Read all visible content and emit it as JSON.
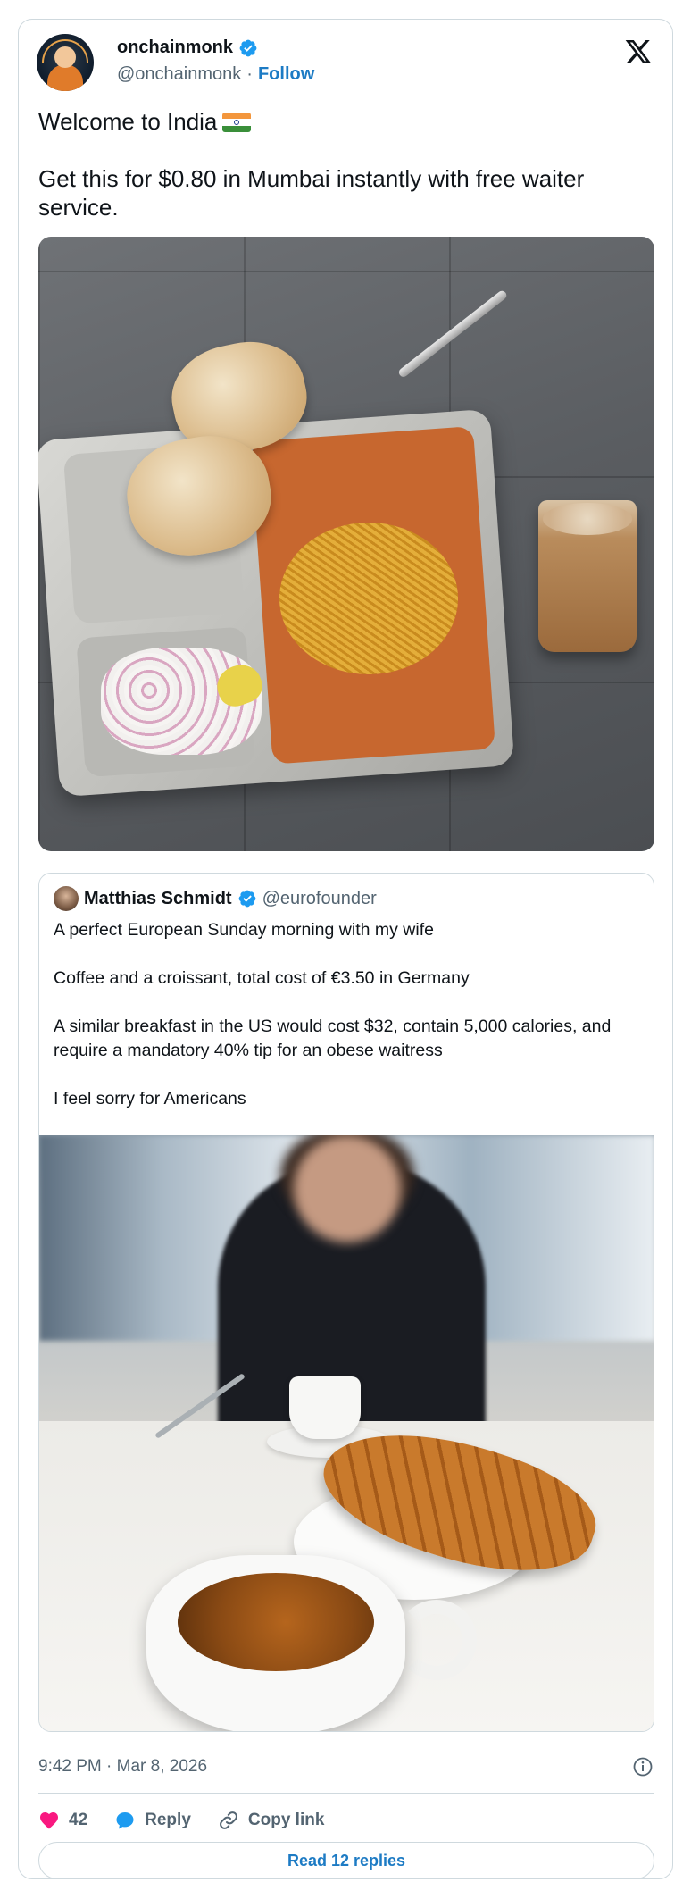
{
  "author": {
    "display_name": "onchainmonk",
    "handle": "@onchainmonk",
    "separator": "·",
    "follow_label": "Follow"
  },
  "post": {
    "line1": "Welcome to India",
    "line2": "Get this for $0.80 in Mumbai instantly with free waiter service."
  },
  "quoted": {
    "display_name": "Matthias Schmidt",
    "handle": "@eurofounder",
    "paragraphs": [
      "A perfect European Sunday morning with my wife",
      "Coffee and a croissant, total cost of €3.50 in Germany",
      "A similar breakfast in the US would cost $32, contain 5,000 calories, and require a mandatory 40% tip for an obese waitress",
      "I feel sorry for Americans"
    ]
  },
  "footer": {
    "timestamp": "9:42 PM · Mar 8, 2026",
    "like_count": "42",
    "reply_label": "Reply",
    "copy_link_label": "Copy link",
    "read_replies_label": "Read 12 replies"
  },
  "colors": {
    "accent": "#1d7bc4",
    "verified": "#1d9bf0",
    "like": "#f91880",
    "text": "#0f1419",
    "muted": "#536471",
    "border": "#cfd9de"
  },
  "icons": [
    "verified-badge-icon",
    "x-logo-icon",
    "india-flag-icon",
    "info-icon",
    "heart-icon",
    "reply-bubble-icon",
    "link-icon"
  ]
}
